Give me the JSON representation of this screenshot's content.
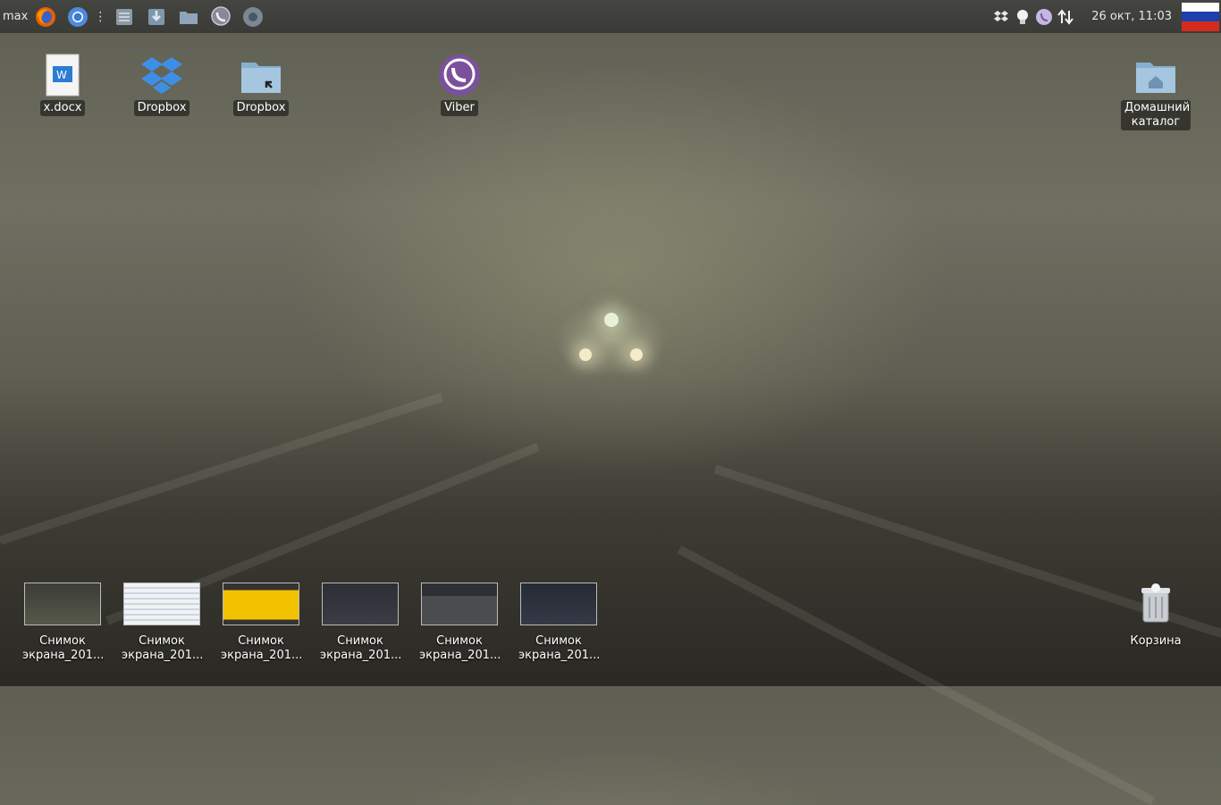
{
  "topbar": {
    "user": "max",
    "launcher": [
      {
        "name": "firefox-icon"
      },
      {
        "name": "chrome-icon"
      },
      {
        "name": "files-grey-icon"
      },
      {
        "name": "downloads-icon"
      },
      {
        "name": "folder-icon"
      },
      {
        "name": "viber-icon"
      },
      {
        "name": "chromium-icon"
      }
    ],
    "tray": [
      "dropbox-icon",
      "bulb-icon",
      "viber-icon",
      "network-arrows-icon"
    ],
    "clock": "26 окт, 11:03",
    "flag_colors": [
      "#ffffff",
      "#1c3fae",
      "#d52b1e"
    ]
  },
  "desktop": {
    "icons": [
      {
        "label": "x.docx"
      },
      {
        "label": "Dropbox"
      },
      {
        "label": "Dropbox"
      },
      {
        "label": "Viber"
      },
      {
        "label": "Домашний каталог"
      }
    ],
    "screenshots": [
      {
        "label": "Снимок экрана_201..."
      },
      {
        "label": "Снимок экрана_201..."
      },
      {
        "label": "Снимок экрана_201..."
      },
      {
        "label": "Снимок экрана_201..."
      },
      {
        "label": "Снимок экрана_201..."
      },
      {
        "label": "Снимок экрана_201..."
      }
    ],
    "trash": {
      "label": "Корзина"
    }
  },
  "colors": {
    "viber": "#7b519d",
    "dropbox": "#3d8fe6",
    "folder": "#86b0cf"
  }
}
